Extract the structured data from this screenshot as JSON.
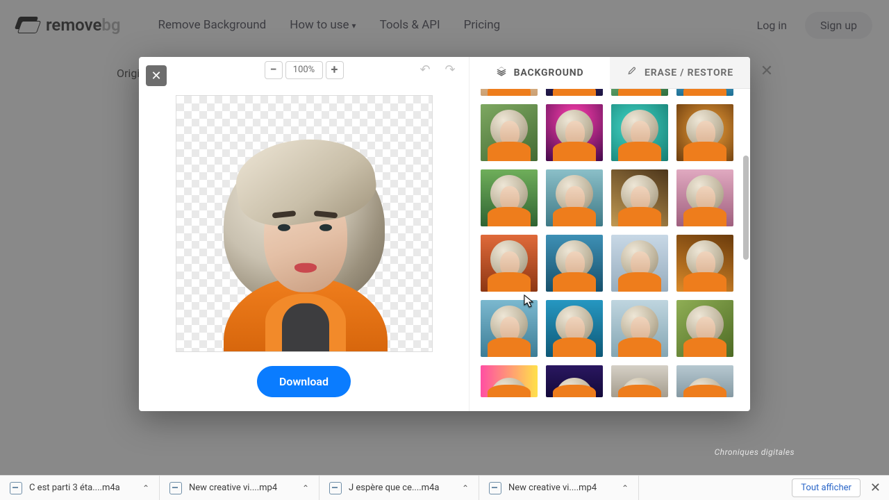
{
  "nav": {
    "logo_a": "remove",
    "logo_b": "bg",
    "links": [
      "Remove Background",
      "How to use",
      "Tools & API",
      "Pricing"
    ],
    "login": "Log in",
    "signup": "Sign up"
  },
  "behind_tab": "Original",
  "zoom": "100%",
  "download": "Download",
  "tabs": {
    "bg": "BACKGROUND",
    "erase": "ERASE / RESTORE"
  },
  "backgrounds": [
    [
      {
        "g": "linear-gradient(#efc79a,#caa074)"
      },
      {
        "g": "linear-gradient(#3a2f77,#1d1541)"
      },
      {
        "g": "linear-gradient(160deg,#7bbf84,#2f7040)"
      },
      {
        "g": "linear-gradient(#6fc5e8,#1e6f94)"
      }
    ],
    [
      {
        "g": "linear-gradient(150deg,#7ea861,#436a33)"
      },
      {
        "g": "radial-gradient(circle at 50% 25%,#ff3fae,#43094a)"
      },
      {
        "g": "radial-gradient(circle at 40% 40%,#41d6c7,#167d72)"
      },
      {
        "g": "radial-gradient(circle at 55% 45%,#f2a23a,#6b3c0e)"
      }
    ],
    [
      {
        "g": "linear-gradient(#6fae5a,#2f6332)"
      },
      {
        "g": "linear-gradient(#8bbfc8,#3e7986)"
      },
      {
        "g": "linear-gradient(30deg,#c29a53,#4d361b)"
      },
      {
        "g": "linear-gradient(#e0a9c0,#9f5f7e)"
      }
    ],
    [
      {
        "g": "linear-gradient(#e06a3a,#8d3714)"
      },
      {
        "g": "linear-gradient(#3e90b5,#17506b)"
      },
      {
        "g": "linear-gradient(#c8d8e6,#97adbe)"
      },
      {
        "g": "linear-gradient(20deg,#d98a2a,#6a3b0c)"
      }
    ],
    [
      {
        "g": "linear-gradient(#7bb8cf,#3d7d96)"
      },
      {
        "g": "linear-gradient(#2697c1,#0e5876)"
      },
      {
        "g": "linear-gradient(#bfd5df,#84a6b3)"
      },
      {
        "g": "linear-gradient(140deg,#8fae55,#4d6a24)"
      }
    ],
    [
      {
        "g": "linear-gradient(90deg,#ff4fa3,#ffe14a)"
      },
      {
        "g": "linear-gradient(#2a1760,#13093a)"
      },
      {
        "g": "linear-gradient(#d5d0c6,#a49c8d)"
      },
      {
        "g": "linear-gradient(#b6c8d0,#8599a3)"
      }
    ]
  ],
  "shelf": {
    "items": [
      {
        "name": "C est parti 3 éta....m4a"
      },
      {
        "name": "New creative vi....mp4"
      },
      {
        "name": "J espère que ce....m4a"
      },
      {
        "name": "New creative vi....mp4"
      }
    ],
    "show_all": "Tout afficher"
  },
  "watermark": "Chroniques digitales"
}
